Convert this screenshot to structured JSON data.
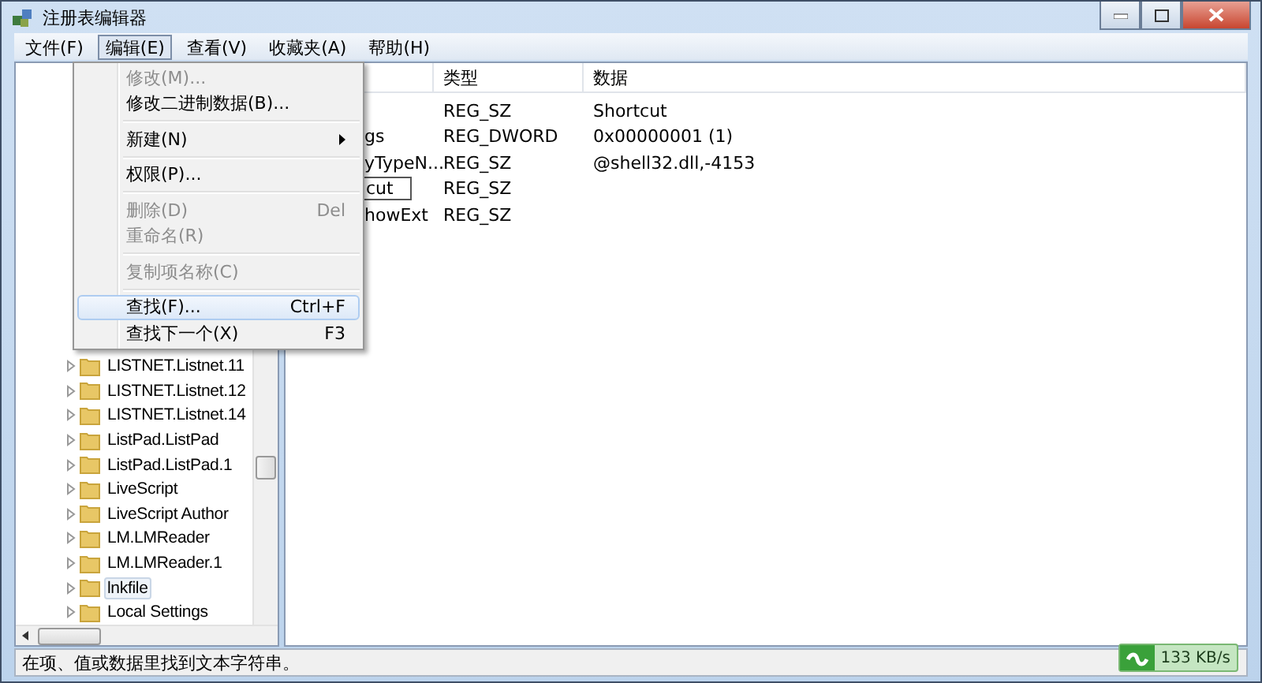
{
  "window": {
    "title": "注册表编辑器"
  },
  "menu_bar": [
    {
      "label": "文件(F)",
      "selected": false
    },
    {
      "label": "编辑(E)",
      "selected": true
    },
    {
      "label": "查看(V)",
      "selected": false
    },
    {
      "label": "收藏夹(A)",
      "selected": false
    },
    {
      "label": "帮助(H)",
      "selected": false
    }
  ],
  "edit_menu": {
    "items": [
      {
        "kind": "item",
        "label": "修改(M)...",
        "disabled": true,
        "selected": false
      },
      {
        "kind": "item",
        "label": "修改二进制数据(B)...",
        "disabled": false,
        "selected": false
      },
      {
        "kind": "separator"
      },
      {
        "kind": "item",
        "label": "新建(N)",
        "disabled": false,
        "selected": false,
        "submenu": true
      },
      {
        "kind": "separator"
      },
      {
        "kind": "item",
        "label": "权限(P)...",
        "disabled": false,
        "selected": false
      },
      {
        "kind": "separator"
      },
      {
        "kind": "item",
        "label": "删除(D)",
        "shortcut": "Del",
        "disabled": true,
        "selected": false
      },
      {
        "kind": "item",
        "label": "重命名(R)",
        "disabled": true,
        "selected": false
      },
      {
        "kind": "separator"
      },
      {
        "kind": "item",
        "label": "复制项名称(C)",
        "disabled": true,
        "selected": false
      },
      {
        "kind": "separator"
      },
      {
        "kind": "item",
        "label": "查找(F)...",
        "shortcut": "Ctrl+F",
        "disabled": false,
        "selected": true
      },
      {
        "kind": "item",
        "label": "查找下一个(X)",
        "shortcut": "F3",
        "disabled": false,
        "selected": false
      }
    ]
  },
  "tree": {
    "items": [
      {
        "label": "LISTNET.Listnet.11",
        "selected": false
      },
      {
        "label": "LISTNET.Listnet.12",
        "selected": false
      },
      {
        "label": "LISTNET.Listnet.14",
        "selected": false
      },
      {
        "label": "ListPad.ListPad",
        "selected": false
      },
      {
        "label": "ListPad.ListPad.1",
        "selected": false
      },
      {
        "label": "LiveScript",
        "selected": false
      },
      {
        "label": "LiveScript Author",
        "selected": false
      },
      {
        "label": "LM.LMReader",
        "selected": false
      },
      {
        "label": "LM.LMReader.1",
        "selected": false
      },
      {
        "label": "lnkfile",
        "selected": true
      },
      {
        "label": "Local Settings",
        "selected": false
      }
    ]
  },
  "values": {
    "columns": [
      "类型",
      "数据"
    ],
    "rows": [
      {
        "type": "REG_SZ",
        "data": "Shortcut",
        "editing": false
      },
      {
        "name": "gs",
        "type": "REG_DWORD",
        "data": "0x00000001 (1)",
        "editing": false
      },
      {
        "name": "yTypeN...",
        "type": "REG_SZ",
        "data": "@shell32.dll,-4153",
        "editing": false
      },
      {
        "name": "cut",
        "type": "REG_SZ",
        "editing": true
      },
      {
        "name": "howExt",
        "type": "REG_SZ",
        "editing": false
      }
    ]
  },
  "status_bar": {
    "text": "在项、值或数据里找到文本字符串。"
  },
  "network_meter": {
    "speed": "133 KB/s"
  }
}
